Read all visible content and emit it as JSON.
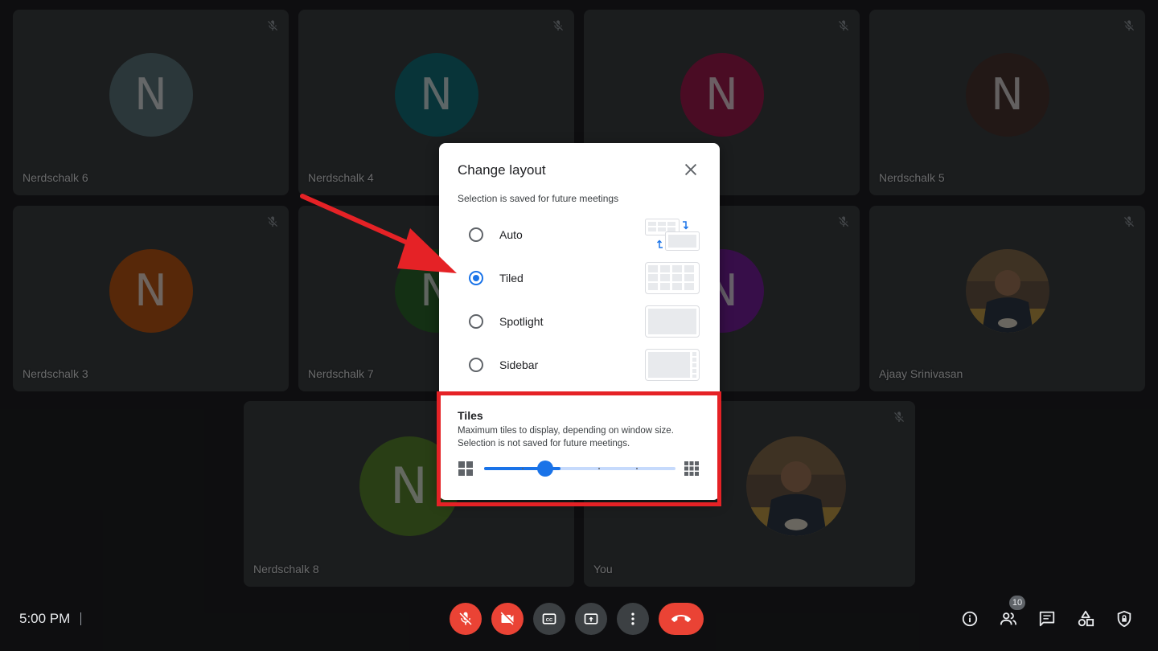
{
  "participants": [
    {
      "name": "Nerdschalk 6",
      "initial": "N",
      "color": "#5f7a80"
    },
    {
      "name": "Nerdschalk 4",
      "initial": "N",
      "color": "#12737e"
    },
    {
      "name": "",
      "initial": "N",
      "color": "#a51c50"
    },
    {
      "name": "Nerdschalk 5",
      "initial": "N",
      "color": "#4d3631"
    },
    {
      "name": "Nerdschalk 3",
      "initial": "N",
      "color": "#c15a15"
    },
    {
      "name": "Nerdschalk 7",
      "initial": "N",
      "color": "#2e6b2e"
    },
    {
      "name": "",
      "initial": "N",
      "color": "#7b1fa2"
    },
    {
      "name": "Ajaay Srinivasan",
      "initial": "",
      "color": "#6d5a47"
    },
    {
      "name": "Nerdschalk 8",
      "initial": "N",
      "color": "#5c8a30"
    },
    {
      "name": "You",
      "initial": "",
      "color": "#6d5a47"
    }
  ],
  "dialog": {
    "title": "Change layout",
    "subtitle": "Selection is saved for future meetings",
    "options": [
      {
        "label": "Auto",
        "selected": false
      },
      {
        "label": "Tiled",
        "selected": true
      },
      {
        "label": "Spotlight",
        "selected": false
      },
      {
        "label": "Sidebar",
        "selected": false
      }
    ],
    "tiles": {
      "heading": "Tiles",
      "description": "Maximum tiles to display, depending on window size. Selection is not saved for future meetings.",
      "slider_value": 0.32
    }
  },
  "bottom_bar": {
    "time": "5:00 PM",
    "people_count": "10"
  },
  "colors": {
    "accent": "#1a73e8",
    "danger": "#ea4335",
    "highlight": "#e52226"
  }
}
